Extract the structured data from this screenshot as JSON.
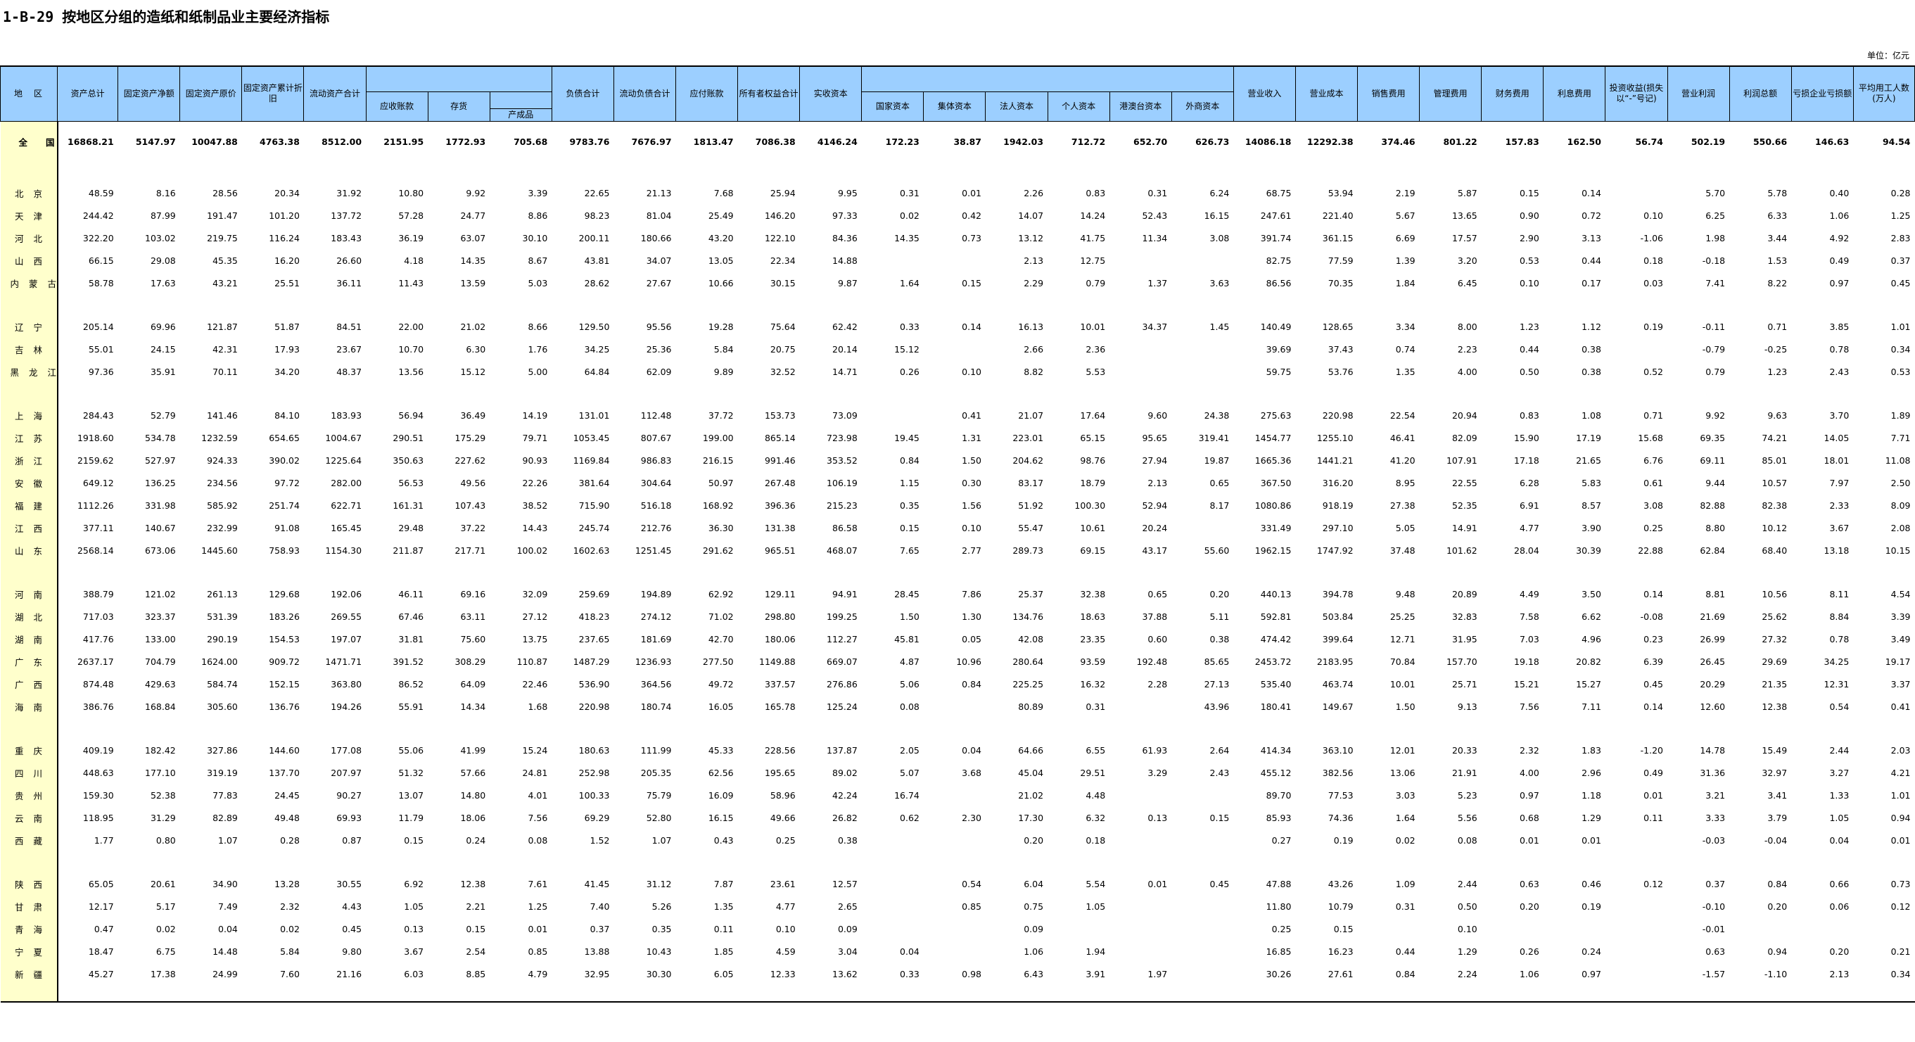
{
  "title": "1-B-29  按地区分组的造纸和纸制品业主要经济指标",
  "unit": "单位：亿元",
  "headers": {
    "region": "地　区",
    "assets": "资产总计",
    "fixed_net": "固定资产净额",
    "fixed_orig": "固定资产原价",
    "depr": "固定资产累计折旧",
    "current_assets": "流动资产合计",
    "receivable": "应收账款",
    "inventory": "存货",
    "finished": "产成品",
    "liabilities": "负债合计",
    "current_liab": "流动负债合计",
    "payable": "应付账款",
    "equity": "所有者权益合计",
    "paid_capital": "实收资本",
    "state": "国家资本",
    "collective": "集体资本",
    "legal": "法人资本",
    "personal": "个人资本",
    "hmt": "港澳台资本",
    "foreign": "外商资本",
    "revenue": "营业收入",
    "cost": "营业成本",
    "selling": "销售费用",
    "admin": "管理费用",
    "finance": "财务费用",
    "interest": "利息费用",
    "invest": "投资收益(损失以“-”号记)",
    "op_profit": "营业利润",
    "total_profit": "利润总额",
    "loss": "亏损企业亏损额",
    "employees": "平均用工人数(万人)"
  },
  "rows": [
    {
      "region": "全国",
      "vals": [
        "16868.21",
        "5147.97",
        "10047.88",
        "4763.38",
        "8512.00",
        "2151.95",
        "1772.93",
        "705.68",
        "9783.76",
        "7676.97",
        "1813.47",
        "7086.38",
        "4146.24",
        "172.23",
        "38.87",
        "1942.03",
        "712.72",
        "652.70",
        "626.73",
        "14086.18",
        "12292.38",
        "374.46",
        "801.22",
        "157.83",
        "162.50",
        "56.74",
        "502.19",
        "550.66",
        "146.63",
        "94.54"
      ]
    },
    {
      "region": "北京",
      "vals": [
        "48.59",
        "8.16",
        "28.56",
        "20.34",
        "31.92",
        "10.80",
        "9.92",
        "3.39",
        "22.65",
        "21.13",
        "7.68",
        "25.94",
        "9.95",
        "0.31",
        "0.01",
        "2.26",
        "0.83",
        "0.31",
        "6.24",
        "68.75",
        "53.94",
        "2.19",
        "5.87",
        "0.15",
        "0.14",
        "",
        "5.70",
        "5.78",
        "0.40",
        "0.28"
      ]
    },
    {
      "region": "天津",
      "vals": [
        "244.42",
        "87.99",
        "191.47",
        "101.20",
        "137.72",
        "57.28",
        "24.77",
        "8.86",
        "98.23",
        "81.04",
        "25.49",
        "146.20",
        "97.33",
        "0.02",
        "0.42",
        "14.07",
        "14.24",
        "52.43",
        "16.15",
        "247.61",
        "221.40",
        "5.67",
        "13.65",
        "0.90",
        "0.72",
        "0.10",
        "6.25",
        "6.33",
        "1.06",
        "1.25"
      ]
    },
    {
      "region": "河北",
      "vals": [
        "322.20",
        "103.02",
        "219.75",
        "116.24",
        "183.43",
        "36.19",
        "63.07",
        "30.10",
        "200.11",
        "180.66",
        "43.20",
        "122.10",
        "84.36",
        "14.35",
        "0.73",
        "13.12",
        "41.75",
        "11.34",
        "3.08",
        "391.74",
        "361.15",
        "6.69",
        "17.57",
        "2.90",
        "3.13",
        "-1.06",
        "1.98",
        "3.44",
        "4.92",
        "2.83"
      ]
    },
    {
      "region": "山西",
      "vals": [
        "66.15",
        "29.08",
        "45.35",
        "16.20",
        "26.60",
        "4.18",
        "14.35",
        "8.67",
        "43.81",
        "34.07",
        "13.05",
        "22.34",
        "14.88",
        "",
        "",
        "2.13",
        "12.75",
        "",
        "",
        "82.75",
        "77.59",
        "1.39",
        "3.20",
        "0.53",
        "0.44",
        "0.18",
        "-0.18",
        "1.53",
        "0.49",
        "0.37"
      ]
    },
    {
      "region": "内蒙古",
      "vals": [
        "58.78",
        "17.63",
        "43.21",
        "25.51",
        "36.11",
        "11.43",
        "13.59",
        "5.03",
        "28.62",
        "27.67",
        "10.66",
        "30.15",
        "9.87",
        "1.64",
        "0.15",
        "2.29",
        "0.79",
        "1.37",
        "3.63",
        "86.56",
        "70.35",
        "1.84",
        "6.45",
        "0.10",
        "0.17",
        "0.03",
        "7.41",
        "8.22",
        "0.97",
        "0.45"
      ]
    },
    {
      "region": "辽宁",
      "vals": [
        "205.14",
        "69.96",
        "121.87",
        "51.87",
        "84.51",
        "22.00",
        "21.02",
        "8.66",
        "129.50",
        "95.56",
        "19.28",
        "75.64",
        "62.42",
        "0.33",
        "0.14",
        "16.13",
        "10.01",
        "34.37",
        "1.45",
        "140.49",
        "128.65",
        "3.34",
        "8.00",
        "1.23",
        "1.12",
        "0.19",
        "-0.11",
        "0.71",
        "3.85",
        "1.01"
      ]
    },
    {
      "region": "吉林",
      "vals": [
        "55.01",
        "24.15",
        "42.31",
        "17.93",
        "23.67",
        "10.70",
        "6.30",
        "1.76",
        "34.25",
        "25.36",
        "5.84",
        "20.75",
        "20.14",
        "15.12",
        "",
        "2.66",
        "2.36",
        "",
        "",
        "39.69",
        "37.43",
        "0.74",
        "2.23",
        "0.44",
        "0.38",
        "",
        "-0.79",
        "-0.25",
        "0.78",
        "0.34"
      ]
    },
    {
      "region": "黑龙江",
      "vals": [
        "97.36",
        "35.91",
        "70.11",
        "34.20",
        "48.37",
        "13.56",
        "15.12",
        "5.00",
        "64.84",
        "62.09",
        "9.89",
        "32.52",
        "14.71",
        "0.26",
        "0.10",
        "8.82",
        "5.53",
        "",
        "",
        "59.75",
        "53.76",
        "1.35",
        "4.00",
        "0.50",
        "0.38",
        "0.52",
        "0.79",
        "1.23",
        "2.43",
        "0.53"
      ]
    },
    {
      "region": "上海",
      "vals": [
        "284.43",
        "52.79",
        "141.46",
        "84.10",
        "183.93",
        "56.94",
        "36.49",
        "14.19",
        "131.01",
        "112.48",
        "37.72",
        "153.73",
        "73.09",
        "",
        "0.41",
        "21.07",
        "17.64",
        "9.60",
        "24.38",
        "275.63",
        "220.98",
        "22.54",
        "20.94",
        "0.83",
        "1.08",
        "0.71",
        "9.92",
        "9.63",
        "3.70",
        "1.89"
      ]
    },
    {
      "region": "江苏",
      "vals": [
        "1918.60",
        "534.78",
        "1232.59",
        "654.65",
        "1004.67",
        "290.51",
        "175.29",
        "79.71",
        "1053.45",
        "807.67",
        "199.00",
        "865.14",
        "723.98",
        "19.45",
        "1.31",
        "223.01",
        "65.15",
        "95.65",
        "319.41",
        "1454.77",
        "1255.10",
        "46.41",
        "82.09",
        "15.90",
        "17.19",
        "15.68",
        "69.35",
        "74.21",
        "14.05",
        "7.71"
      ]
    },
    {
      "region": "浙江",
      "vals": [
        "2159.62",
        "527.97",
        "924.33",
        "390.02",
        "1225.64",
        "350.63",
        "227.62",
        "90.93",
        "1169.84",
        "986.83",
        "216.15",
        "991.46",
        "353.52",
        "0.84",
        "1.50",
        "204.62",
        "98.76",
        "27.94",
        "19.87",
        "1665.36",
        "1441.21",
        "41.20",
        "107.91",
        "17.18",
        "21.65",
        "6.76",
        "69.11",
        "85.01",
        "18.01",
        "11.08"
      ]
    },
    {
      "region": "安徽",
      "vals": [
        "649.12",
        "136.25",
        "234.56",
        "97.72",
        "282.00",
        "56.53",
        "49.56",
        "22.26",
        "381.64",
        "304.64",
        "50.97",
        "267.48",
        "106.19",
        "1.15",
        "0.30",
        "83.17",
        "18.79",
        "2.13",
        "0.65",
        "367.50",
        "316.20",
        "8.95",
        "22.55",
        "6.28",
        "5.83",
        "0.61",
        "9.44",
        "10.57",
        "7.97",
        "2.50"
      ]
    },
    {
      "region": "福建",
      "vals": [
        "1112.26",
        "331.98",
        "585.92",
        "251.74",
        "622.71",
        "161.31",
        "107.43",
        "38.52",
        "715.90",
        "516.18",
        "168.92",
        "396.36",
        "215.23",
        "0.35",
        "1.56",
        "51.92",
        "100.30",
        "52.94",
        "8.17",
        "1080.86",
        "918.19",
        "27.38",
        "52.35",
        "6.91",
        "8.57",
        "3.08",
        "82.88",
        "82.38",
        "2.33",
        "8.09"
      ]
    },
    {
      "region": "江西",
      "vals": [
        "377.11",
        "140.67",
        "232.99",
        "91.08",
        "165.45",
        "29.48",
        "37.22",
        "14.43",
        "245.74",
        "212.76",
        "36.30",
        "131.38",
        "86.58",
        "0.15",
        "0.10",
        "55.47",
        "10.61",
        "20.24",
        "",
        "331.49",
        "297.10",
        "5.05",
        "14.91",
        "4.77",
        "3.90",
        "0.25",
        "8.80",
        "10.12",
        "3.67",
        "2.08"
      ]
    },
    {
      "region": "山东",
      "vals": [
        "2568.14",
        "673.06",
        "1445.60",
        "758.93",
        "1154.30",
        "211.87",
        "217.71",
        "100.02",
        "1602.63",
        "1251.45",
        "291.62",
        "965.51",
        "468.07",
        "7.65",
        "2.77",
        "289.73",
        "69.15",
        "43.17",
        "55.60",
        "1962.15",
        "1747.92",
        "37.48",
        "101.62",
        "28.04",
        "30.39",
        "22.88",
        "62.84",
        "68.40",
        "13.18",
        "10.15"
      ]
    },
    {
      "region": "河南",
      "vals": [
        "388.79",
        "121.02",
        "261.13",
        "129.68",
        "192.06",
        "46.11",
        "69.16",
        "32.09",
        "259.69",
        "194.89",
        "62.92",
        "129.11",
        "94.91",
        "28.45",
        "7.86",
        "25.37",
        "32.38",
        "0.65",
        "0.20",
        "440.13",
        "394.78",
        "9.48",
        "20.89",
        "4.49",
        "3.50",
        "0.14",
        "8.81",
        "10.56",
        "8.11",
        "4.54"
      ]
    },
    {
      "region": "湖北",
      "vals": [
        "717.03",
        "323.37",
        "531.39",
        "183.26",
        "269.55",
        "67.46",
        "63.11",
        "27.12",
        "418.23",
        "274.12",
        "71.02",
        "298.80",
        "199.25",
        "1.50",
        "1.30",
        "134.76",
        "18.63",
        "37.88",
        "5.11",
        "592.81",
        "503.84",
        "25.25",
        "32.83",
        "7.58",
        "6.62",
        "-0.08",
        "21.69",
        "25.62",
        "8.84",
        "3.39"
      ]
    },
    {
      "region": "湖南",
      "vals": [
        "417.76",
        "133.00",
        "290.19",
        "154.53",
        "197.07",
        "31.81",
        "75.60",
        "13.75",
        "237.65",
        "181.69",
        "42.70",
        "180.06",
        "112.27",
        "45.81",
        "0.05",
        "42.08",
        "23.35",
        "0.60",
        "0.38",
        "474.42",
        "399.64",
        "12.71",
        "31.95",
        "7.03",
        "4.96",
        "0.23",
        "26.99",
        "27.32",
        "0.78",
        "3.49"
      ]
    },
    {
      "region": "广东",
      "vals": [
        "2637.17",
        "704.79",
        "1624.00",
        "909.72",
        "1471.71",
        "391.52",
        "308.29",
        "110.87",
        "1487.29",
        "1236.93",
        "277.50",
        "1149.88",
        "669.07",
        "4.87",
        "10.96",
        "280.64",
        "93.59",
        "192.48",
        "85.65",
        "2453.72",
        "2183.95",
        "70.84",
        "157.70",
        "19.18",
        "20.82",
        "6.39",
        "26.45",
        "29.69",
        "34.25",
        "19.17"
      ]
    },
    {
      "region": "广西",
      "vals": [
        "874.48",
        "429.63",
        "584.74",
        "152.15",
        "363.80",
        "86.52",
        "64.09",
        "22.46",
        "536.90",
        "364.56",
        "49.72",
        "337.57",
        "276.86",
        "5.06",
        "0.84",
        "225.25",
        "16.32",
        "2.28",
        "27.13",
        "535.40",
        "463.74",
        "10.01",
        "25.71",
        "15.21",
        "15.27",
        "0.45",
        "20.29",
        "21.35",
        "12.31",
        "3.37"
      ]
    },
    {
      "region": "海南",
      "vals": [
        "386.76",
        "168.84",
        "305.60",
        "136.76",
        "194.26",
        "55.91",
        "14.34",
        "1.68",
        "220.98",
        "180.74",
        "16.05",
        "165.78",
        "125.24",
        "0.08",
        "",
        "80.89",
        "0.31",
        "",
        "43.96",
        "180.41",
        "149.67",
        "1.50",
        "9.13",
        "7.56",
        "7.11",
        "0.14",
        "12.60",
        "12.38",
        "0.54",
        "0.41"
      ]
    },
    {
      "region": "重庆",
      "vals": [
        "409.19",
        "182.42",
        "327.86",
        "144.60",
        "177.08",
        "55.06",
        "41.99",
        "15.24",
        "180.63",
        "111.99",
        "45.33",
        "228.56",
        "137.87",
        "2.05",
        "0.04",
        "64.66",
        "6.55",
        "61.93",
        "2.64",
        "414.34",
        "363.10",
        "12.01",
        "20.33",
        "2.32",
        "1.83",
        "-1.20",
        "14.78",
        "15.49",
        "2.44",
        "2.03"
      ]
    },
    {
      "region": "四川",
      "vals": [
        "448.63",
        "177.10",
        "319.19",
        "137.70",
        "207.97",
        "51.32",
        "57.66",
        "24.81",
        "252.98",
        "205.35",
        "62.56",
        "195.65",
        "89.02",
        "5.07",
        "3.68",
        "45.04",
        "29.51",
        "3.29",
        "2.43",
        "455.12",
        "382.56",
        "13.06",
        "21.91",
        "4.00",
        "2.96",
        "0.49",
        "31.36",
        "32.97",
        "3.27",
        "4.21"
      ]
    },
    {
      "region": "贵州",
      "vals": [
        "159.30",
        "52.38",
        "77.83",
        "24.45",
        "90.27",
        "13.07",
        "14.80",
        "4.01",
        "100.33",
        "75.79",
        "16.09",
        "58.96",
        "42.24",
        "16.74",
        "",
        "21.02",
        "4.48",
        "",
        "",
        "89.70",
        "77.53",
        "3.03",
        "5.23",
        "0.97",
        "1.18",
        "0.01",
        "3.21",
        "3.41",
        "1.33",
        "1.01"
      ]
    },
    {
      "region": "云南",
      "vals": [
        "118.95",
        "31.29",
        "82.89",
        "49.48",
        "69.93",
        "11.79",
        "18.06",
        "7.56",
        "69.29",
        "52.80",
        "16.15",
        "49.66",
        "26.82",
        "0.62",
        "2.30",
        "17.30",
        "6.32",
        "0.13",
        "0.15",
        "85.93",
        "74.36",
        "1.64",
        "5.56",
        "0.68",
        "1.29",
        "0.11",
        "3.33",
        "3.79",
        "1.05",
        "0.94"
      ]
    },
    {
      "region": "西藏",
      "vals": [
        "1.77",
        "0.80",
        "1.07",
        "0.28",
        "0.87",
        "0.15",
        "0.24",
        "0.08",
        "1.52",
        "1.07",
        "0.43",
        "0.25",
        "0.38",
        "",
        "",
        "0.20",
        "0.18",
        "",
        "",
        "0.27",
        "0.19",
        "0.02",
        "0.08",
        "0.01",
        "0.01",
        "",
        "-0.03",
        "-0.04",
        "0.04",
        "0.01"
      ]
    },
    {
      "region": "陕西",
      "vals": [
        "65.05",
        "20.61",
        "34.90",
        "13.28",
        "30.55",
        "6.92",
        "12.38",
        "7.61",
        "41.45",
        "31.12",
        "7.87",
        "23.61",
        "12.57",
        "",
        "0.54",
        "6.04",
        "5.54",
        "0.01",
        "0.45",
        "47.88",
        "43.26",
        "1.09",
        "2.44",
        "0.63",
        "0.46",
        "0.12",
        "0.37",
        "0.84",
        "0.66",
        "0.73"
      ]
    },
    {
      "region": "甘肃",
      "vals": [
        "12.17",
        "5.17",
        "7.49",
        "2.32",
        "4.43",
        "1.05",
        "2.21",
        "1.25",
        "7.40",
        "5.26",
        "1.35",
        "4.77",
        "2.65",
        "",
        "0.85",
        "0.75",
        "1.05",
        "",
        "",
        "11.80",
        "10.79",
        "0.31",
        "0.50",
        "0.20",
        "0.19",
        "",
        "-0.10",
        "0.20",
        "0.06",
        "0.12"
      ]
    },
    {
      "region": "青海",
      "vals": [
        "0.47",
        "0.02",
        "0.04",
        "0.02",
        "0.45",
        "0.13",
        "0.15",
        "0.01",
        "0.37",
        "0.35",
        "0.11",
        "0.10",
        "0.09",
        "",
        "",
        "0.09",
        "",
        "",
        "",
        "0.25",
        "0.15",
        "",
        "0.10",
        "",
        "",
        "",
        "-0.01",
        "",
        "",
        ""
      ]
    },
    {
      "region": "宁夏",
      "vals": [
        "18.47",
        "6.75",
        "14.48",
        "5.84",
        "9.80",
        "3.67",
        "2.54",
        "0.85",
        "13.88",
        "10.43",
        "1.85",
        "4.59",
        "3.04",
        "0.04",
        "",
        "1.06",
        "1.94",
        "",
        "",
        "16.85",
        "16.23",
        "0.44",
        "1.29",
        "0.26",
        "0.24",
        "",
        "0.63",
        "0.94",
        "0.20",
        "0.21"
      ]
    },
    {
      "region": "新疆",
      "vals": [
        "45.27",
        "17.38",
        "24.99",
        "7.60",
        "21.16",
        "6.03",
        "8.85",
        "4.79",
        "32.95",
        "30.30",
        "6.05",
        "12.33",
        "13.62",
        "0.33",
        "0.98",
        "6.43",
        "3.91",
        "1.97",
        "",
        "30.26",
        "27.61",
        "0.84",
        "2.24",
        "1.06",
        "0.97",
        "",
        "-1.57",
        "-1.10",
        "2.13",
        "0.34"
      ]
    }
  ]
}
